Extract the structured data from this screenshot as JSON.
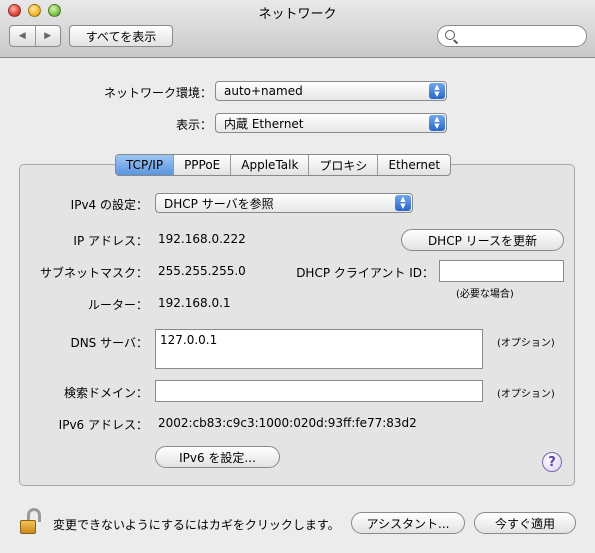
{
  "window": {
    "title": "ネットワーク"
  },
  "toolbar": {
    "back_icon": "back-arrow-icon",
    "forward_icon": "forward-arrow-icon",
    "show_all_label": "すべてを表示",
    "search_placeholder": ""
  },
  "top": {
    "location_label": "ネットワーク環境：",
    "location_value": "auto+named",
    "show_label": "表示：",
    "show_value": "内蔵 Ethernet"
  },
  "tabs": [
    {
      "label": "TCP/IP",
      "active": true
    },
    {
      "label": "PPPoE",
      "active": false
    },
    {
      "label": "AppleTalk",
      "active": false
    },
    {
      "label": "プロキシ",
      "active": false
    },
    {
      "label": "Ethernet",
      "active": false
    }
  ],
  "tcpip": {
    "ipv4_config_label": "IPv4 の設定：",
    "ipv4_config_value": "DHCP サーバを参照",
    "ip_label": "IP アドレス：",
    "ip_value": "192.168.0.222",
    "renew_button": "DHCP リースを更新",
    "subnet_label": "サブネットマスク：",
    "subnet_value": "255.255.255.0",
    "client_id_label": "DHCP クライアント ID：",
    "client_id_value": "",
    "client_id_note": "(必要な場合)",
    "router_label": "ルーター：",
    "router_value": "192.168.0.1",
    "dns_label": "DNS サーバ：",
    "dns_value": "127.0.0.1",
    "dns_note": "(オプション)",
    "search_domain_label": "検索ドメイン：",
    "search_domain_value": "",
    "search_domain_note": "(オプション)",
    "ipv6_label": "IPv6 アドレス：",
    "ipv6_value": "2002:cb83:c9c3:1000:020d:93ff:fe77:83d2",
    "ipv6_button": "IPv6 を設定...",
    "help_label": "?"
  },
  "footer": {
    "lock_text": "変更できないようにするにはカギをクリックします。",
    "assistant_button": "アシスタント...",
    "apply_button": "今すぐ適用"
  }
}
